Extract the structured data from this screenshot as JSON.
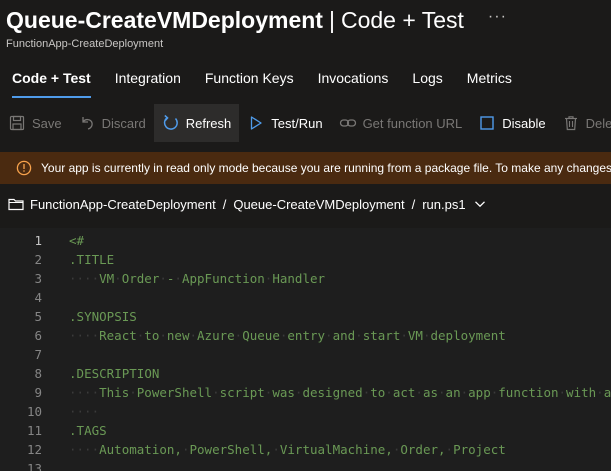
{
  "header": {
    "title_main": "Queue-CreateVMDeployment",
    "title_separator": "|",
    "title_sub": "Code + Test",
    "more_label": "···",
    "subtitle": "FunctionApp-CreateDeployment"
  },
  "tabs": [
    {
      "label": "Code + Test",
      "active": true
    },
    {
      "label": "Integration"
    },
    {
      "label": "Function Keys"
    },
    {
      "label": "Invocations"
    },
    {
      "label": "Logs"
    },
    {
      "label": "Metrics"
    }
  ],
  "toolbar": {
    "save": "Save",
    "discard": "Discard",
    "refresh": "Refresh",
    "test_run": "Test/Run",
    "get_url": "Get function URL",
    "disable": "Disable",
    "delete": "Delete"
  },
  "banner": {
    "text": "Your app is currently in read only mode because you are running from a package file. To make any changes update"
  },
  "breadcrumb": {
    "app": "FunctionApp-CreateDeployment",
    "function": "Queue-CreateVMDeployment",
    "file": "run.ps1",
    "separator": "/"
  },
  "editor": {
    "lines": [
      {
        "n": "1",
        "indent": "",
        "text": "<#"
      },
      {
        "n": "2",
        "indent": "",
        "text": ".TITLE"
      },
      {
        "n": "3",
        "indent": "····",
        "text": "VM·Order·-·AppFunction·Handler"
      },
      {
        "n": "4",
        "indent": "",
        "text": ""
      },
      {
        "n": "5",
        "indent": "",
        "text": ".SYNOPSIS"
      },
      {
        "n": "6",
        "indent": "····",
        "text": "React·to·new·Azure·Queue·entry·and·start·VM·deployment"
      },
      {
        "n": "7",
        "indent": "",
        "text": ""
      },
      {
        "n": "8",
        "indent": "",
        "text": ".DESCRIPTION"
      },
      {
        "n": "9",
        "indent": "····",
        "text": "This·PowerShell·script·was·designed·to·act·as·an·app·function·with·a"
      },
      {
        "n": "10",
        "indent": "····",
        "text": ""
      },
      {
        "n": "11",
        "indent": "",
        "text": ".TAGS"
      },
      {
        "n": "12",
        "indent": "····",
        "text": "Automation,·PowerShell,·VirtualMachine,·Order,·Project"
      },
      {
        "n": "13",
        "indent": "",
        "text": ""
      }
    ]
  },
  "colors": {
    "accent": "#4f9bea",
    "banner_bg": "#4a2a10",
    "banner_icon": "#f7a24c",
    "comment_green": "#6a9955"
  }
}
